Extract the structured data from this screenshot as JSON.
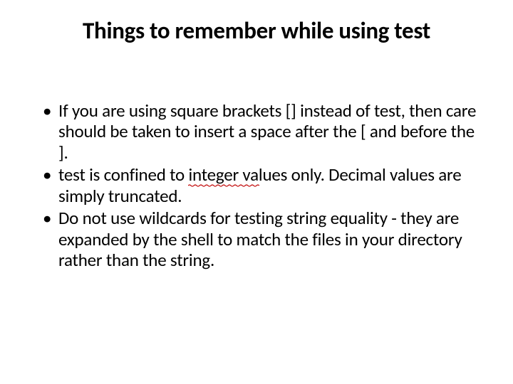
{
  "title": "Things to remember while using test",
  "bullets": {
    "b1": "If you are using square brackets [] instead of test, then care should be taken to insert a space after the [ and before the ].",
    "b2_pre": "test is confined to ",
    "b2_word": "integer values",
    "b2_post": " only. Decimal values are simply truncated.",
    "b3": "Do not use wildcards for testing string equality - they are expanded by the shell to match the files in your directory rather than the string."
  }
}
